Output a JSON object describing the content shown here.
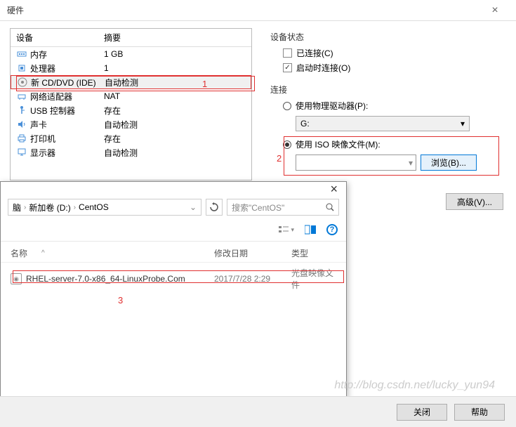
{
  "window": {
    "title": "硬件",
    "close_btn": "关闭",
    "help_btn": "帮助"
  },
  "device_list": {
    "header_device": "设备",
    "header_summary": "摘要",
    "items": [
      {
        "icon": "memory",
        "name": "内存",
        "summary": "1 GB"
      },
      {
        "icon": "cpu",
        "name": "处理器",
        "summary": "1"
      },
      {
        "icon": "cd",
        "name": "新 CD/DVD (IDE)",
        "summary": "自动检测",
        "selected": true
      },
      {
        "icon": "network",
        "name": "网络适配器",
        "summary": "NAT"
      },
      {
        "icon": "usb",
        "name": "USB 控制器",
        "summary": "存在"
      },
      {
        "icon": "sound",
        "name": "声卡",
        "summary": "自动检测"
      },
      {
        "icon": "printer",
        "name": "打印机",
        "summary": "存在"
      },
      {
        "icon": "display",
        "name": "显示器",
        "summary": "自动检测"
      }
    ]
  },
  "right": {
    "status_label": "设备状态",
    "connected_label": "已连接(C)",
    "autostart_label": "启动时连接(O)",
    "connection_label": "连接",
    "physical_drive_label": "使用物理驱动器(P):",
    "drive_value": "G:",
    "iso_label": "使用 ISO 映像文件(M):",
    "browse_btn": "浏览(B)...",
    "advanced_btn": "高级(V)..."
  },
  "callouts": {
    "c1": "1",
    "c2": "2",
    "c3": "3"
  },
  "file_browser": {
    "path_segments": [
      "脑",
      "新加卷 (D:)",
      "CentOS"
    ],
    "search_placeholder": "搜索\"CentOS\"",
    "col_name": "名称",
    "col_date": "修改日期",
    "col_type": "类型",
    "file": {
      "name": "RHEL-server-7.0-x86_64-LinuxProbe.Com",
      "date": "2017/7/28 2:29",
      "type": "光盘映像文件"
    }
  },
  "watermark": "http://blog.csdn.net/lucky_yun94"
}
